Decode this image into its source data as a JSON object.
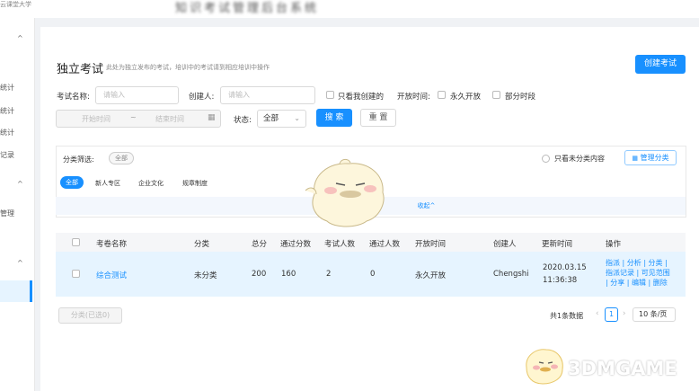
{
  "header": {
    "brand": "云课堂大学",
    "title": "知识考试管理后台系统"
  },
  "sidebar": {
    "items": [
      {
        "label": "统计",
        "top": 0
      },
      {
        "label": "统计"
      },
      {
        "label": "统计"
      },
      {
        "label": "记录"
      },
      {
        "label": "管理"
      }
    ],
    "chevrons": [
      "^",
      "^",
      "^"
    ]
  },
  "page": {
    "title": "独立考试",
    "description": "此处为独立发布的考试，培训中的考试请到相应培训中操作",
    "create_button": "创建考试"
  },
  "search": {
    "name_label": "考试名称:",
    "name_placeholder": "请输入",
    "creator_label": "创建人:",
    "creator_placeholder": "请输入",
    "only_mine": "只看我创建的",
    "open_time_label": "开放时间:",
    "open_forever": "永久开放",
    "open_partial": "部分时段",
    "start_time": "开始时间",
    "end_time": "结束时间",
    "status_label": "状态:",
    "status_value": "全部",
    "search_button": "搜 索",
    "reset_button": "重 置"
  },
  "filter": {
    "label": "分类筛选:",
    "all_tag": "全部",
    "only_uncategorized": "只看未分类内容",
    "manage_button": "管理分类",
    "categories": [
      "全部",
      "新人专区",
      "企业文化",
      "规章制度"
    ],
    "collapse": "收起^"
  },
  "table": {
    "columns": [
      "考卷名称",
      "分类",
      "总分",
      "通过分数",
      "考试人数",
      "通过人数",
      "开放时间",
      "创建人",
      "更新时间",
      "操作"
    ],
    "rows": [
      {
        "name": "综合测试",
        "category": "未分类",
        "total": "200",
        "pass_score": "160",
        "exam_count": "2",
        "pass_count": "0",
        "open_time": "永久开放",
        "creator": "Chengshi",
        "updated_date": "2020.03.15",
        "updated_time": "11:36:38",
        "ops_line1": "指派 | 分析 | 分类 |",
        "ops_line2": "指派记录 | 可见范围",
        "ops_line3": "| 分享 | 编辑 | 删除"
      }
    ]
  },
  "footer": {
    "batch_button": "分类(已选0)",
    "total_text": "共1条数据",
    "prev": "‹",
    "page": "1",
    "next": "›",
    "page_size": "10 条/页"
  },
  "overlay": {
    "collapse_bubble": "收起^"
  },
  "watermark": {
    "text": "3DMGAME"
  },
  "colors": {
    "primary": "#1890ff",
    "row_highlight": "#e6f4ff",
    "bg": "#f0f2f5"
  }
}
